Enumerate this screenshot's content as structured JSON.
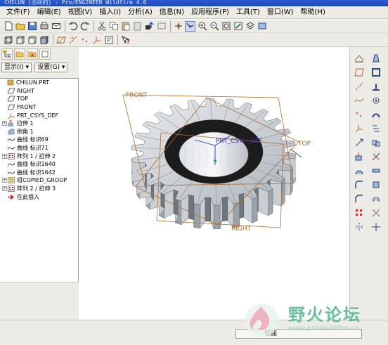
{
  "window": {
    "title": "CHILUN (活动的) - Pro/ENGINEER Wildfire 4.0"
  },
  "menu": [
    "文件(F)",
    "编辑(E)",
    "视图(V)",
    "插入(I)",
    "分析(A)",
    "信息(N)",
    "应用程序(P)",
    "工具(T)",
    "窗口(W)",
    "帮助(H)"
  ],
  "toolbar1_icons": [
    "new-icon",
    "open-icon",
    "save-icon",
    "print-icon",
    "email-icon",
    "undo-icon",
    "redo-icon",
    "cut-icon",
    "copy-icon",
    "paste-icon",
    "paste-special-icon",
    "regenerate-icon",
    "select-box-icon",
    "spin-center-icon",
    "orient-icon",
    "zoom-in-icon",
    "zoom-out-icon",
    "refit-icon",
    "repaint-icon",
    "layers-icon",
    "saved-views-icon"
  ],
  "toolbar2_icons": [
    "wireframe-icon",
    "hidden-line-icon",
    "no-hidden-icon",
    "shading-icon",
    "plane-display-icon",
    "axis-display-icon",
    "point-display-icon",
    "csys-display-icon",
    "annotation-display-icon",
    "context-help-icon"
  ],
  "panel": {
    "show_label": "显示(I) ▾",
    "settings_label": "设置(G) ▾"
  },
  "tree": [
    {
      "label": "CHILUN.PRT",
      "icon": "part-icon",
      "expander": ""
    },
    {
      "label": "RIGHT",
      "icon": "datum-plane-icon",
      "expander": ""
    },
    {
      "label": "TOP",
      "icon": "datum-plane-icon",
      "expander": ""
    },
    {
      "label": "FRONT",
      "icon": "datum-plane-icon",
      "expander": ""
    },
    {
      "label": "PRT_CSYS_DEF",
      "icon": "csys-icon",
      "expander": ""
    },
    {
      "label": "拉伸 1",
      "icon": "extrude-icon",
      "expander": "+"
    },
    {
      "label": "倒角 1",
      "icon": "chamfer-icon",
      "expander": ""
    },
    {
      "label": "曲线 标识69",
      "icon": "curve-icon",
      "expander": ""
    },
    {
      "label": "曲线 标识71",
      "icon": "curve-icon",
      "expander": ""
    },
    {
      "label": "阵列 1 / 拉伸 2",
      "icon": "pattern-icon",
      "expander": "+"
    },
    {
      "label": "曲线 标识1640",
      "icon": "curve-icon",
      "expander": ""
    },
    {
      "label": "曲线 标识1642",
      "icon": "curve-icon",
      "expander": ""
    },
    {
      "label": "组COPIED_GROUP",
      "icon": "group-icon",
      "expander": "+"
    },
    {
      "label": "阵列 2 / 拉伸 3",
      "icon": "pattern-icon",
      "expander": "+"
    },
    {
      "label": "在此插入",
      "icon": "insert-here-arrow-icon",
      "expander": ""
    }
  ],
  "viewport": {
    "front": "FRONT",
    "top": "TOP",
    "right": "RIGHT",
    "csys": "PRT_CSYS_DEF"
  },
  "right_toolbar_icons": [
    "datum-axis-icon",
    "datum-plane-icon",
    "datum-axis-line-icon",
    "datum-curve-icon",
    "datum-point-icon",
    "datum-csys-icon",
    "sketch-icon",
    "extrude-icon",
    "revolve-icon",
    "round-icon",
    "chamfer-icon",
    "pattern-icon",
    "mirror-icon",
    "draft-icon",
    "shell-icon",
    "rib-icon",
    "hole-icon",
    "sweep-icon",
    "blend-icon",
    "merge-icon",
    "trim-icon",
    "thicken-icon",
    "solidify-icon",
    "offset-icon",
    "project-icon",
    "intersect-icon"
  ],
  "status": {
    "filter": "智能"
  },
  "watermark": {
    "title": "野火论坛",
    "url": "www.proewildfire.cn"
  },
  "colors": {
    "datum": "#b0682a",
    "gear_face": "#cfcfcf",
    "gear_dark": "#1a1a1a",
    "csys": "#2f2fa8",
    "title_bar": "#1f48b8"
  }
}
